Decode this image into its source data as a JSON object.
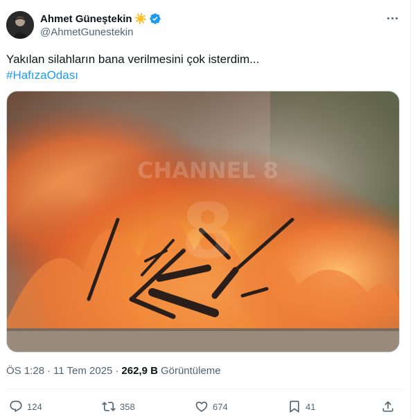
{
  "author": {
    "display_name": "Ahmet Güneştekin",
    "name_emoji": "☀️",
    "handle": "@AhmetGunestekin",
    "verified": true,
    "verified_color": "#1d9bf0"
  },
  "tweet": {
    "text": "Yakılan silahların bana verilmesini çok isterdim...",
    "hashtag": "#HafızaOdası",
    "media_watermark": "CHANNEL 8"
  },
  "meta": {
    "time": "ÖS 1:28",
    "separator": "·",
    "date": "11 Tem 2025",
    "separator2": "·",
    "views_count": "262,9 B",
    "views_label": "Görüntüleme"
  },
  "actions": {
    "replies": "124",
    "reposts": "358",
    "likes": "674",
    "bookmarks": "41"
  },
  "colors": {
    "text": "#0f1419",
    "secondary": "#536471",
    "link": "#1d9bf0",
    "border": "#eff3f4"
  },
  "icons": {
    "more": "more-horizontal-icon",
    "reply": "reply-icon",
    "repost": "repost-icon",
    "like": "heart-icon",
    "bookmark": "bookmark-icon",
    "share": "share-icon"
  }
}
